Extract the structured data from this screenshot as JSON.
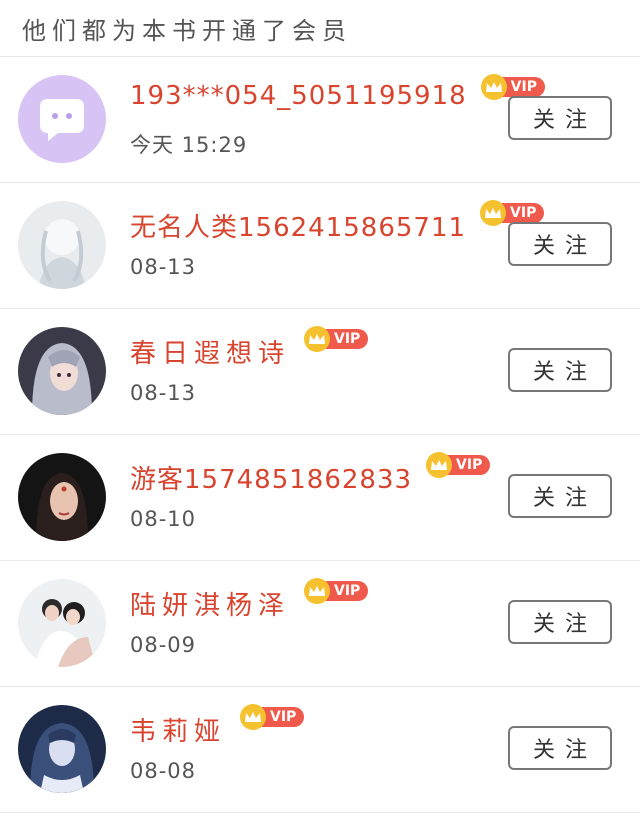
{
  "header": {
    "title": "他们都为本书开通了会员"
  },
  "vip_label": "VIP",
  "follow_label": "关注",
  "members": [
    {
      "name": "193***054_5051195918",
      "time": "今天 15:29",
      "avatar": "chat-bubble-avatar"
    },
    {
      "name": "无名人类1562415865711",
      "time": "08-13",
      "avatar": "white-hair-anime-avatar"
    },
    {
      "name": "春日遐想诗",
      "time": "08-13",
      "avatar": "silver-hair-anime-avatar"
    },
    {
      "name": "游客1574851862833",
      "time": "08-10",
      "avatar": "dark-portrait-avatar"
    },
    {
      "name": "陆妍淇杨泽",
      "time": "08-09",
      "avatar": "couple-photo-avatar"
    },
    {
      "name": "韦莉娅",
      "time": "08-08",
      "avatar": "blue-anime-avatar"
    }
  ],
  "colors": {
    "name": "#d8442e",
    "vip_tag": "#ef5a4c",
    "crown": "#f5c12e",
    "chat_avatar_bg": "#d7c4f5"
  }
}
